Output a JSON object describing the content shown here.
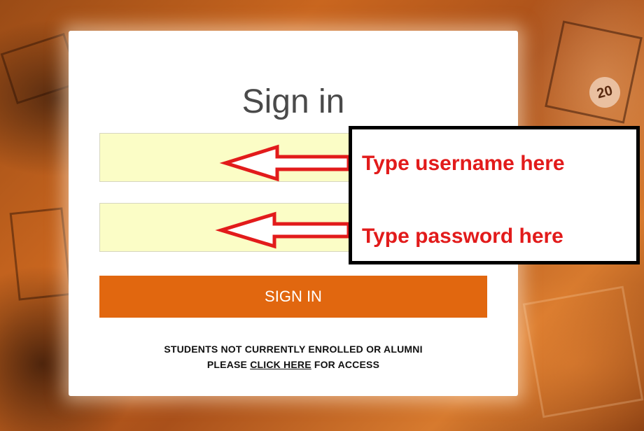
{
  "page": {
    "title": "Sign in",
    "username": {
      "value": "",
      "placeholder": ""
    },
    "password": {
      "value": "",
      "placeholder": ""
    },
    "signin_button": "SIGN IN",
    "footer": {
      "line1": "STUDENTS NOT CURRENTLY ENROLLED OR ALUMNI",
      "prefix": "PLEASE",
      "link": "CLICK HERE",
      "suffix": "FOR ACCESS"
    }
  },
  "background_badge": "20",
  "annotations": {
    "username_label": "Type username here",
    "password_label": "Type password here"
  },
  "colors": {
    "accent": "#e1670f",
    "field_bg": "#fbfdc6",
    "annotation_red": "#e21b1b"
  }
}
